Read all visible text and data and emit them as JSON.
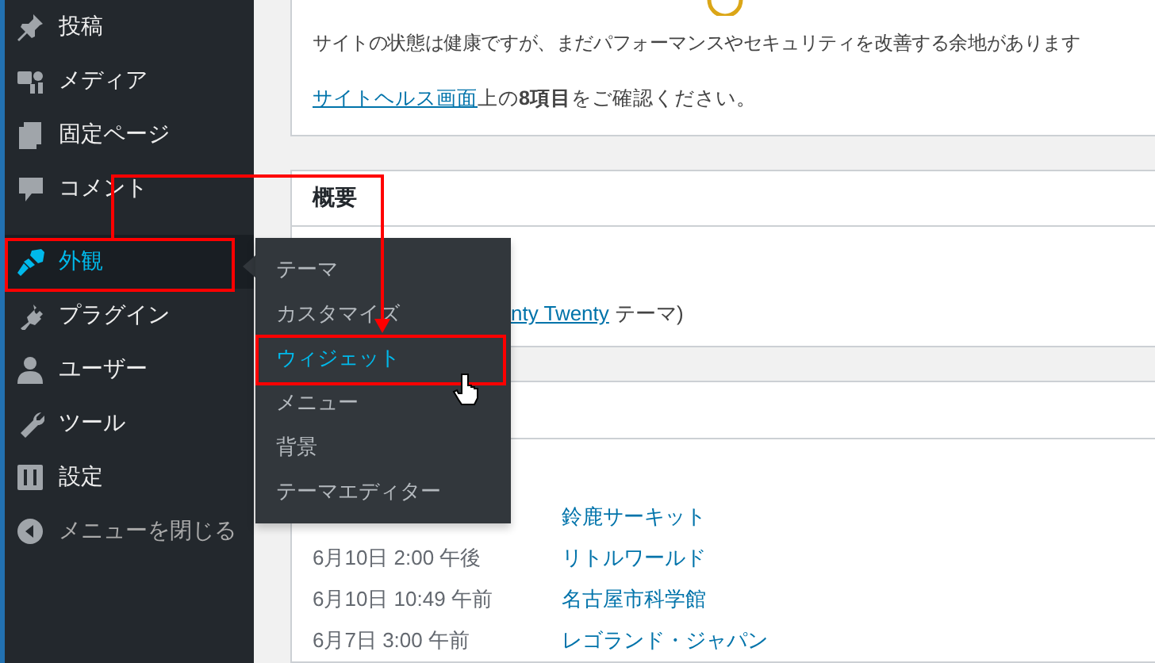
{
  "sidebar": {
    "groups": [
      [
        {
          "label": "投稿",
          "selected": false
        },
        {
          "label": "メディア",
          "selected": false
        },
        {
          "label": "固定ページ",
          "selected": false
        },
        {
          "label": "コメント",
          "selected": false
        }
      ],
      [
        {
          "label": "外観",
          "selected": true
        },
        {
          "label": "プラグイン",
          "selected": false
        },
        {
          "label": "ユーザー",
          "selected": false
        },
        {
          "label": "ツール",
          "selected": false
        },
        {
          "label": "設定",
          "selected": false
        }
      ]
    ],
    "collapse": "メニューを閉じる"
  },
  "flyout": {
    "items": [
      {
        "label": "テーマ",
        "selected": false
      },
      {
        "label": "カスタマイズ",
        "selected": false
      },
      {
        "label": "ウィジェット",
        "selected": true
      },
      {
        "label": "メニュー",
        "selected": false
      },
      {
        "label": "背景",
        "selected": false
      },
      {
        "label": "テーマエディター",
        "selected": false
      }
    ]
  },
  "health": {
    "message": "サイトの状態は健康ですが、まだパフォーマンスやセキュリティを改善する余地があります",
    "link": "サイトヘルス画面",
    "rest": "上の**8項目**をご確認ください。"
  },
  "overview": {
    "title": "概要",
    "theme_link": "nty Twenty",
    "theme_suffix": " テーマ)"
  },
  "activity": {
    "rows": [
      {
        "title": "鈴鹿サーキット"
      },
      {
        "date": "6月10日 2:00 午後",
        "title": "リトルワールド"
      },
      {
        "date": "6月10日 10:49 午前",
        "title": "名古屋市科学館"
      },
      {
        "date": "6月7日 3:00 午前",
        "title": "レゴランド・ジャパン"
      }
    ]
  }
}
